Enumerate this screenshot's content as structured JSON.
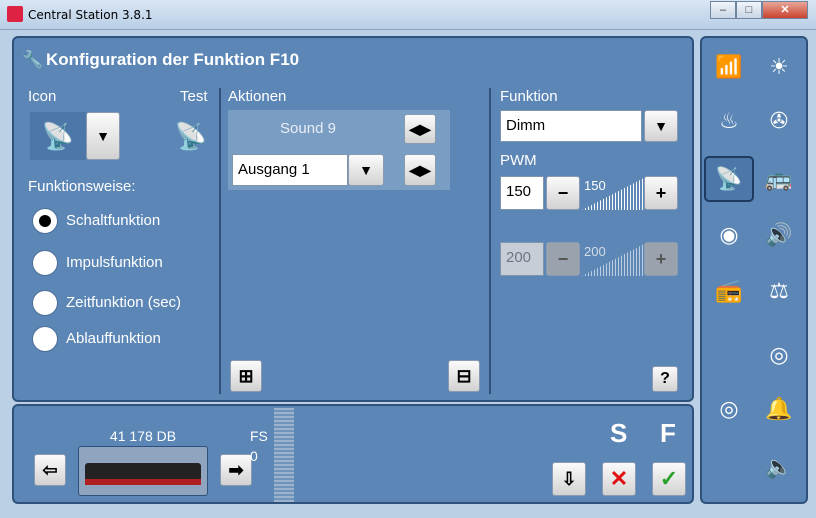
{
  "window": {
    "title": "Central Station 3.8.1",
    "minimize": "–",
    "maximize": "□",
    "close": "✕"
  },
  "header": {
    "title": "Konfiguration der Funktion F10"
  },
  "icon_section": {
    "icon_label": "Icon",
    "test_label": "Test",
    "mode_label": "Funktionsweise:",
    "modes": [
      {
        "label": "Schaltfunktion",
        "selected": true
      },
      {
        "label": "Impulsfunktion",
        "selected": false
      },
      {
        "label": "Zeitfunktion (sec)",
        "selected": false
      },
      {
        "label": "Ablauffunktion",
        "selected": false
      }
    ]
  },
  "actions": {
    "label": "Aktionen",
    "sound": "Sound 9",
    "output": "Ausgang 1"
  },
  "function_section": {
    "label": "Funktion",
    "value": "Dimm",
    "pwm_label": "PWM",
    "pwm_value": "150",
    "pwm_slider_label": "150",
    "pwm2_value": "200",
    "pwm2_slider_label": "200",
    "help": "?"
  },
  "loco": {
    "name": "41 178 DB",
    "fs_label": "FS",
    "fs_value": "0",
    "s_label": "S",
    "f_label": "F"
  },
  "icons": {
    "wrench": "wrench-icon",
    "confirm": "check-icon",
    "cancel": "x-icon"
  }
}
